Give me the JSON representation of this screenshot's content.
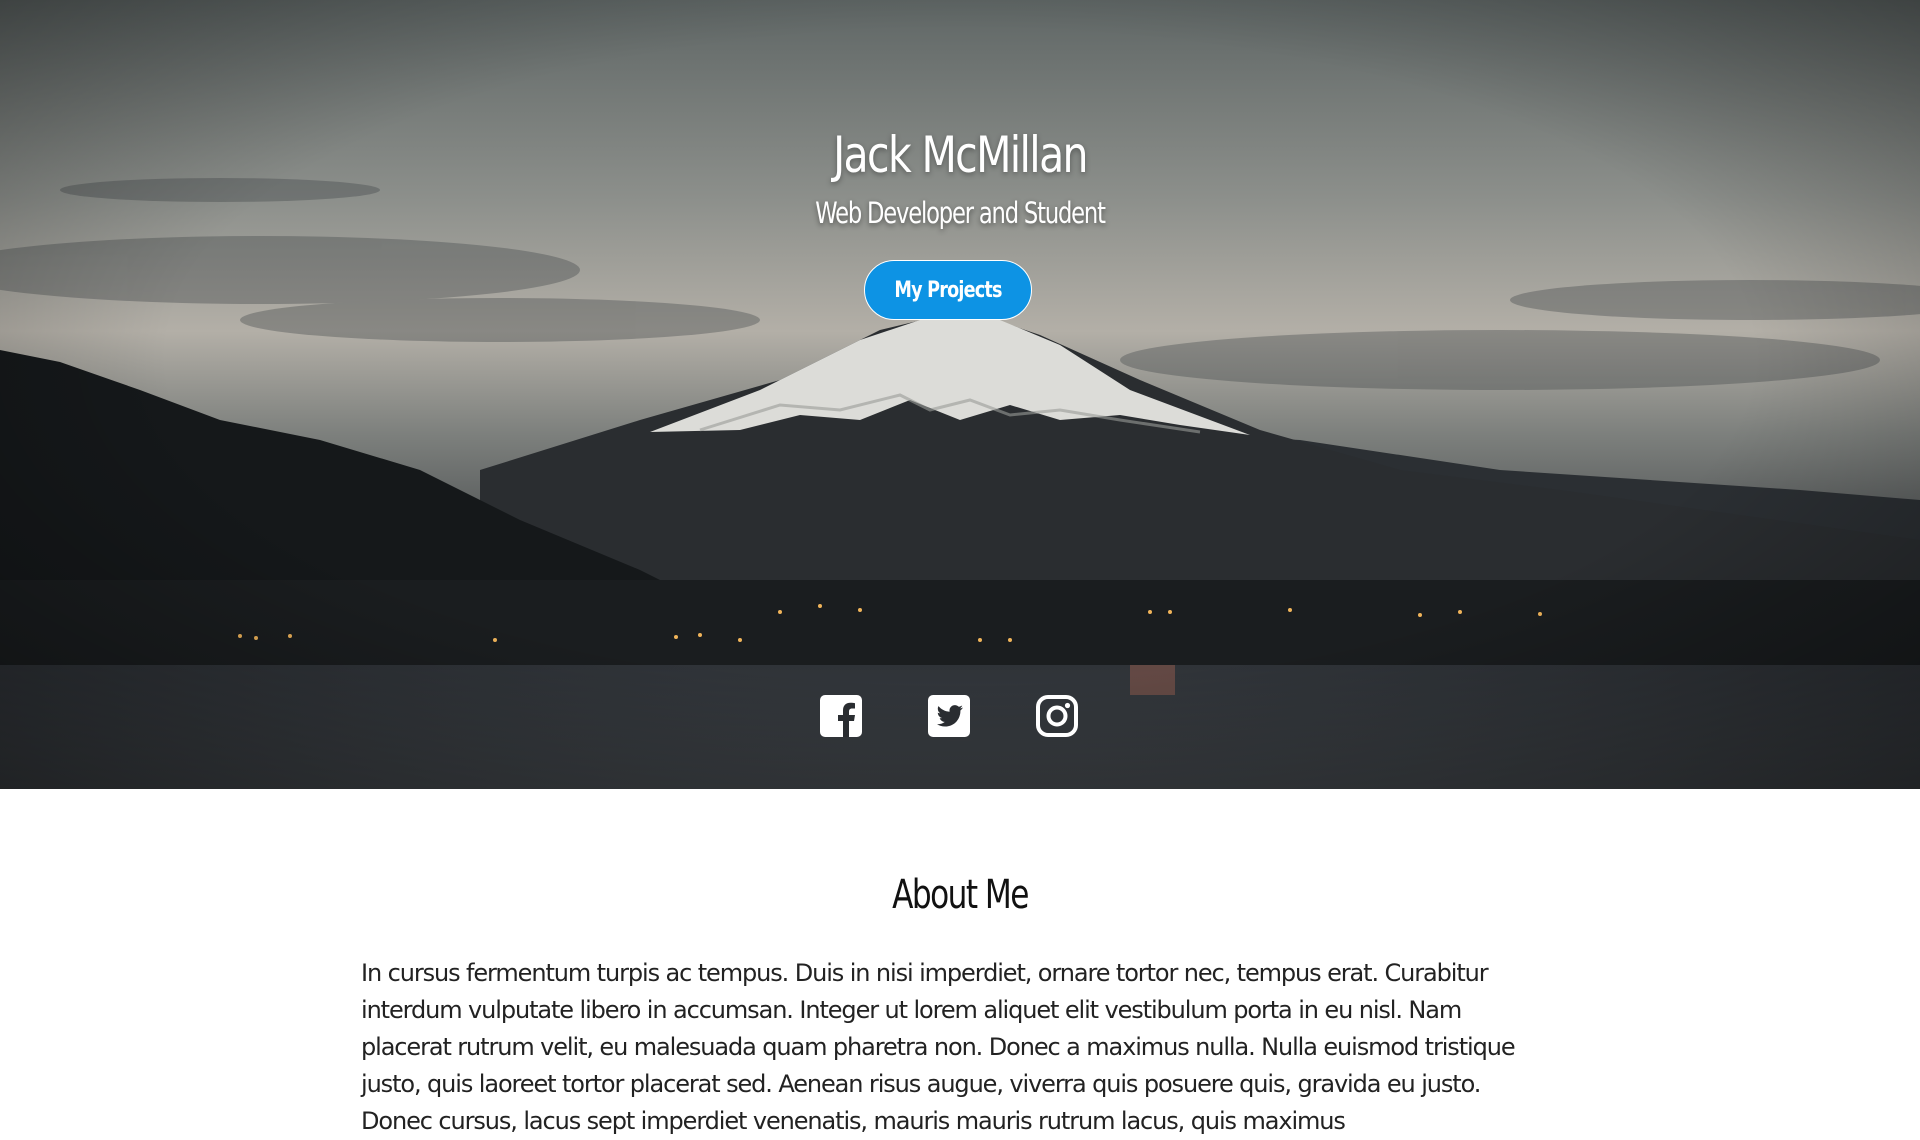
{
  "hero": {
    "title": "Jack McMillan",
    "subtitle": "Web Developer and Student",
    "cta_label": "My Projects",
    "accent": "#0d93e4"
  },
  "social": [
    {
      "name": "facebook",
      "icon": "facebook-icon"
    },
    {
      "name": "twitter",
      "icon": "twitter-icon"
    },
    {
      "name": "instagram",
      "icon": "instagram-icon"
    }
  ],
  "about": {
    "title": "About Me",
    "text": "In cursus fermentum turpis ac tempus. Duis in nisi imperdiet, ornare tortor nec, tempus erat. Curabitur interdum vulputate libero in accumsan. Integer ut lorem aliquet elit vestibulum porta in eu nisl. Nam placerat rutrum velit, eu malesuada quam pharetra non. Donec a maximus nulla. Nulla euismod tristique justo, quis laoreet tortor placerat sed. Aenean risus augue, viverra quis posuere quis, gravida eu justo. Donec cursus, lacus sept imperdiet venenatis, mauris mauris rutrum lacus, quis maximus"
  }
}
